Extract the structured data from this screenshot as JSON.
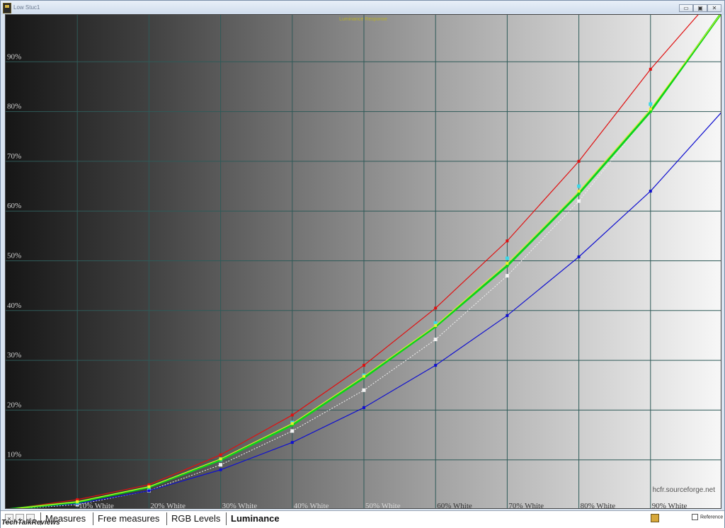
{
  "window": {
    "title": "Low Stuc1",
    "buttons": [
      "▭",
      "▣",
      "✕"
    ]
  },
  "tabs": {
    "nav": [
      "×",
      "‹",
      "›"
    ],
    "items": [
      "Measures",
      "Free measures",
      "RGB Levels",
      "Luminance"
    ],
    "active": "Luminance"
  },
  "status": {
    "reference_label": "Reference"
  },
  "watermark": "hcfr.sourceforge.net",
  "logo": "TechTalkReviews",
  "colors": {
    "red": "#e01010",
    "green": "#0bd41b",
    "blue": "#1010d0",
    "yellow": "#e8f02a",
    "cyan": "#3cd8e8",
    "white": "#f2f2f2",
    "grid": "#2f5a58"
  },
  "chart_data": {
    "type": "line",
    "title": "Luminance Response",
    "categories": [
      "",
      "10% White",
      "20% White",
      "30% White",
      "40% White",
      "50% White",
      "60% White",
      "70% White",
      "80% White",
      "90% White",
      ""
    ],
    "x": [
      0,
      10,
      20,
      30,
      40,
      50,
      60,
      70,
      80,
      90,
      100
    ],
    "ylim": [
      0,
      100
    ],
    "yticks": [
      "10%",
      "20%",
      "30%",
      "40%",
      "50%",
      "60%",
      "70%",
      "80%",
      "90%"
    ],
    "series": [
      {
        "color": "red",
        "values": [
          0,
          2.0,
          5.0,
          11.0,
          19.0,
          29.0,
          40.5,
          54.0,
          70.0,
          88.5,
          105.0
        ]
      },
      {
        "color": "green",
        "values": [
          0,
          1.5,
          4.5,
          10.0,
          17.0,
          26.5,
          36.8,
          49.0,
          63.5,
          80.0,
          100.0
        ]
      },
      {
        "color": "blue",
        "values": [
          0,
          1.2,
          3.8,
          8.0,
          13.5,
          20.5,
          29.0,
          39.0,
          50.8,
          64.0,
          80.0
        ]
      },
      {
        "color": "yellow",
        "values": [
          0,
          1.6,
          4.6,
          10.2,
          17.3,
          26.8,
          37.0,
          49.5,
          64.0,
          80.5,
          100.0
        ]
      },
      {
        "color": "cyan",
        "values": [
          0,
          1.4,
          4.4,
          10.0,
          17.5,
          27.0,
          37.5,
          50.5,
          65.0,
          81.5,
          100.0
        ]
      },
      {
        "color": "white",
        "values": [
          0,
          1.0,
          3.8,
          9.0,
          15.8,
          24.0,
          34.2,
          47.0,
          62.0,
          80.0,
          100.0
        ]
      }
    ]
  }
}
